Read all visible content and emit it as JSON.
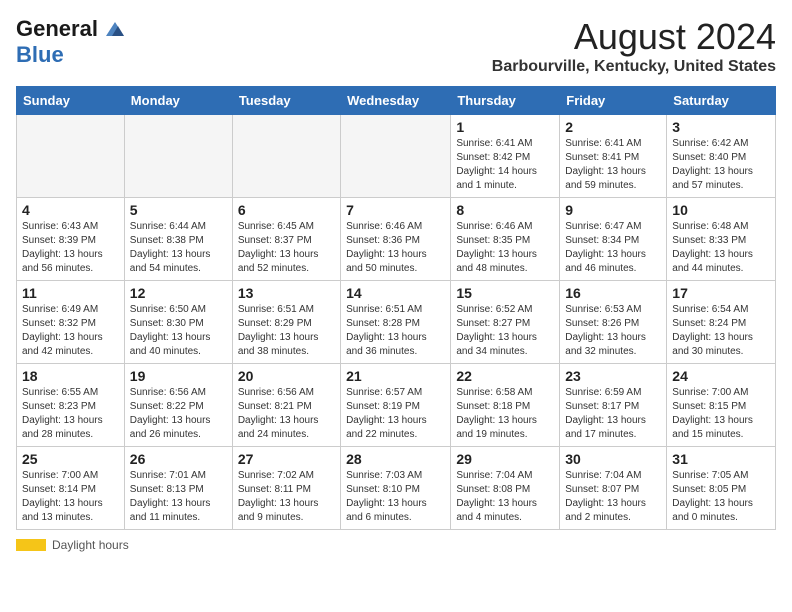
{
  "header": {
    "logo_general": "General",
    "logo_blue": "Blue",
    "month_title": "August 2024",
    "location": "Barbourville, Kentucky, United States"
  },
  "days_of_week": [
    "Sunday",
    "Monday",
    "Tuesday",
    "Wednesday",
    "Thursday",
    "Friday",
    "Saturday"
  ],
  "weeks": [
    [
      {
        "day": "",
        "info": ""
      },
      {
        "day": "",
        "info": ""
      },
      {
        "day": "",
        "info": ""
      },
      {
        "day": "",
        "info": ""
      },
      {
        "day": "1",
        "info": "Sunrise: 6:41 AM\nSunset: 8:42 PM\nDaylight: 14 hours\nand 1 minute."
      },
      {
        "day": "2",
        "info": "Sunrise: 6:41 AM\nSunset: 8:41 PM\nDaylight: 13 hours\nand 59 minutes."
      },
      {
        "day": "3",
        "info": "Sunrise: 6:42 AM\nSunset: 8:40 PM\nDaylight: 13 hours\nand 57 minutes."
      }
    ],
    [
      {
        "day": "4",
        "info": "Sunrise: 6:43 AM\nSunset: 8:39 PM\nDaylight: 13 hours\nand 56 minutes."
      },
      {
        "day": "5",
        "info": "Sunrise: 6:44 AM\nSunset: 8:38 PM\nDaylight: 13 hours\nand 54 minutes."
      },
      {
        "day": "6",
        "info": "Sunrise: 6:45 AM\nSunset: 8:37 PM\nDaylight: 13 hours\nand 52 minutes."
      },
      {
        "day": "7",
        "info": "Sunrise: 6:46 AM\nSunset: 8:36 PM\nDaylight: 13 hours\nand 50 minutes."
      },
      {
        "day": "8",
        "info": "Sunrise: 6:46 AM\nSunset: 8:35 PM\nDaylight: 13 hours\nand 48 minutes."
      },
      {
        "day": "9",
        "info": "Sunrise: 6:47 AM\nSunset: 8:34 PM\nDaylight: 13 hours\nand 46 minutes."
      },
      {
        "day": "10",
        "info": "Sunrise: 6:48 AM\nSunset: 8:33 PM\nDaylight: 13 hours\nand 44 minutes."
      }
    ],
    [
      {
        "day": "11",
        "info": "Sunrise: 6:49 AM\nSunset: 8:32 PM\nDaylight: 13 hours\nand 42 minutes."
      },
      {
        "day": "12",
        "info": "Sunrise: 6:50 AM\nSunset: 8:30 PM\nDaylight: 13 hours\nand 40 minutes."
      },
      {
        "day": "13",
        "info": "Sunrise: 6:51 AM\nSunset: 8:29 PM\nDaylight: 13 hours\nand 38 minutes."
      },
      {
        "day": "14",
        "info": "Sunrise: 6:51 AM\nSunset: 8:28 PM\nDaylight: 13 hours\nand 36 minutes."
      },
      {
        "day": "15",
        "info": "Sunrise: 6:52 AM\nSunset: 8:27 PM\nDaylight: 13 hours\nand 34 minutes."
      },
      {
        "day": "16",
        "info": "Sunrise: 6:53 AM\nSunset: 8:26 PM\nDaylight: 13 hours\nand 32 minutes."
      },
      {
        "day": "17",
        "info": "Sunrise: 6:54 AM\nSunset: 8:24 PM\nDaylight: 13 hours\nand 30 minutes."
      }
    ],
    [
      {
        "day": "18",
        "info": "Sunrise: 6:55 AM\nSunset: 8:23 PM\nDaylight: 13 hours\nand 28 minutes."
      },
      {
        "day": "19",
        "info": "Sunrise: 6:56 AM\nSunset: 8:22 PM\nDaylight: 13 hours\nand 26 minutes."
      },
      {
        "day": "20",
        "info": "Sunrise: 6:56 AM\nSunset: 8:21 PM\nDaylight: 13 hours\nand 24 minutes."
      },
      {
        "day": "21",
        "info": "Sunrise: 6:57 AM\nSunset: 8:19 PM\nDaylight: 13 hours\nand 22 minutes."
      },
      {
        "day": "22",
        "info": "Sunrise: 6:58 AM\nSunset: 8:18 PM\nDaylight: 13 hours\nand 19 minutes."
      },
      {
        "day": "23",
        "info": "Sunrise: 6:59 AM\nSunset: 8:17 PM\nDaylight: 13 hours\nand 17 minutes."
      },
      {
        "day": "24",
        "info": "Sunrise: 7:00 AM\nSunset: 8:15 PM\nDaylight: 13 hours\nand 15 minutes."
      }
    ],
    [
      {
        "day": "25",
        "info": "Sunrise: 7:00 AM\nSunset: 8:14 PM\nDaylight: 13 hours\nand 13 minutes."
      },
      {
        "day": "26",
        "info": "Sunrise: 7:01 AM\nSunset: 8:13 PM\nDaylight: 13 hours\nand 11 minutes."
      },
      {
        "day": "27",
        "info": "Sunrise: 7:02 AM\nSunset: 8:11 PM\nDaylight: 13 hours\nand 9 minutes."
      },
      {
        "day": "28",
        "info": "Sunrise: 7:03 AM\nSunset: 8:10 PM\nDaylight: 13 hours\nand 6 minutes."
      },
      {
        "day": "29",
        "info": "Sunrise: 7:04 AM\nSunset: 8:08 PM\nDaylight: 13 hours\nand 4 minutes."
      },
      {
        "day": "30",
        "info": "Sunrise: 7:04 AM\nSunset: 8:07 PM\nDaylight: 13 hours\nand 2 minutes."
      },
      {
        "day": "31",
        "info": "Sunrise: 7:05 AM\nSunset: 8:05 PM\nDaylight: 13 hours\nand 0 minutes."
      }
    ]
  ],
  "footer": {
    "label": "Daylight hours"
  }
}
